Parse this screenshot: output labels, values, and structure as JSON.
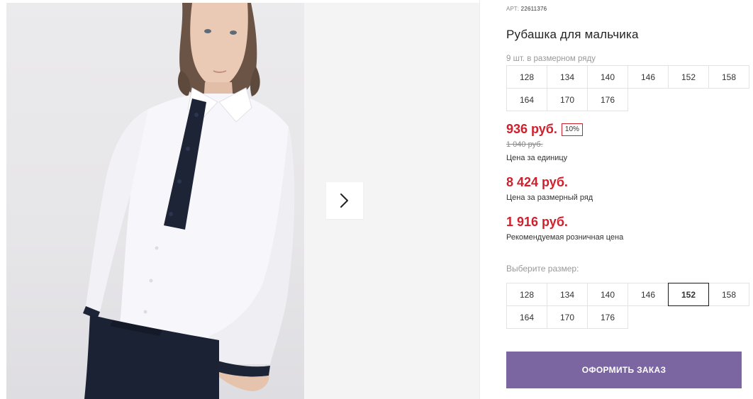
{
  "gallery": {
    "next_icon": "chevron-right-icon"
  },
  "product": {
    "sku_label": "АРТ:",
    "sku_value": "22611376",
    "title": "Рубашка для мальчика",
    "pack_note": "9 шт. в размерном ряду",
    "pack_sizes": [
      "128",
      "134",
      "140",
      "146",
      "152",
      "158",
      "164",
      "170",
      "176"
    ],
    "price": "936 руб.",
    "discount": "10%",
    "old_price": "1 040 руб.",
    "unit_label": "Цена за единицу",
    "pack_price": "8 424 руб.",
    "pack_label": "Цена за размерный ряд",
    "rrp_price": "1 916 руб.",
    "rrp_label": "Рекомендуемая розничная цена",
    "choose_label": "Выберите размер:",
    "sizes": [
      "128",
      "134",
      "140",
      "146",
      "152",
      "158",
      "164",
      "170",
      "176"
    ],
    "selected_size": "152",
    "order_button": "ОФОРМИТЬ ЗАКАЗ"
  },
  "colors": {
    "price_red": "#d0202d",
    "order_button": "#7b66a1"
  }
}
